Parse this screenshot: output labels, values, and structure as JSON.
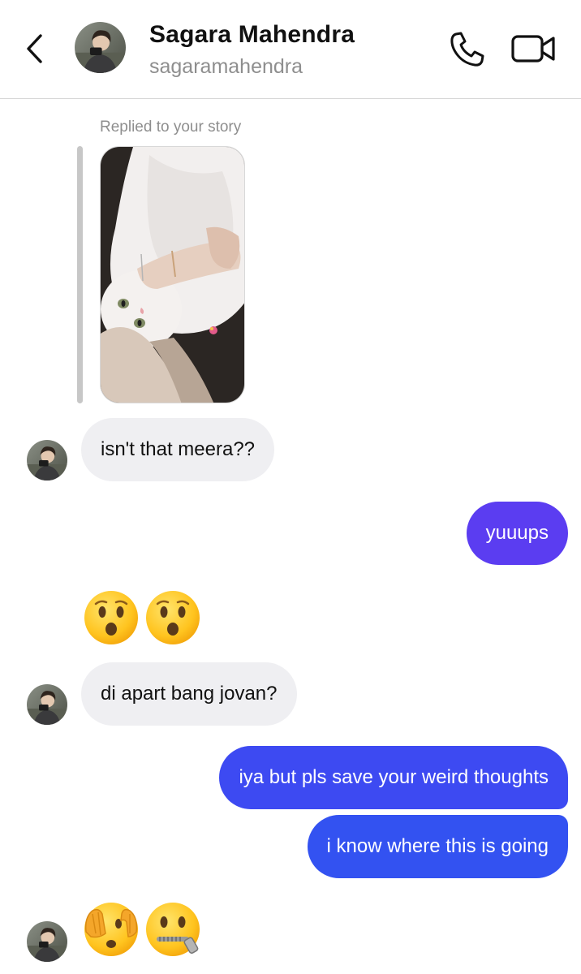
{
  "header": {
    "name": "Sagara Mahendra",
    "handle": "sagaramahendra",
    "back_icon": "chevron-left-icon",
    "call_icon": "phone-icon",
    "video_icon": "video-camera-icon"
  },
  "story_reply": {
    "caption": "Replied to your story"
  },
  "messages": [
    {
      "sender": "them",
      "text": "isn't that meera??"
    },
    {
      "sender": "me",
      "text": "yuuups"
    },
    {
      "sender": "them",
      "type": "emoji",
      "emojis": [
        "hushed-face-emoji",
        "hushed-face-emoji"
      ]
    },
    {
      "sender": "them",
      "text": "di apart bang jovan?"
    },
    {
      "sender": "me",
      "text": "iya but pls save your weird thoughts"
    },
    {
      "sender": "me",
      "text": "i know where this is going"
    },
    {
      "sender": "them",
      "type": "emoji",
      "emojis": [
        "face-with-peeking-eye-emoji",
        "zipper-mouth-face-emoji"
      ]
    }
  ],
  "colors": {
    "outgoing_purple": "#5b3df1",
    "outgoing_blue": "#3352f1",
    "incoming_bg": "#efeff2",
    "secondary_text": "#8e8e8e"
  }
}
